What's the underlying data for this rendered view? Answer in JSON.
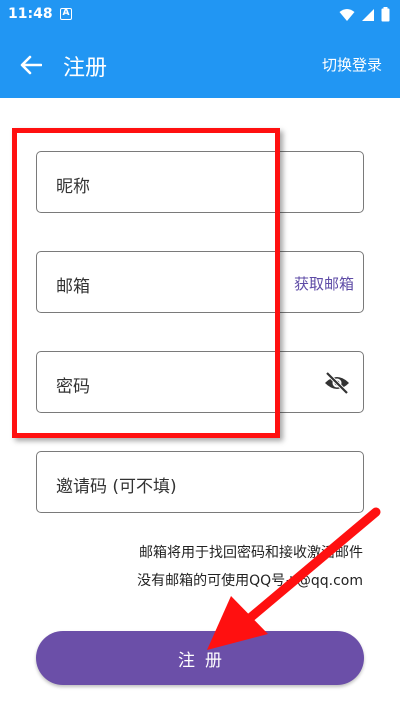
{
  "status_bar": {
    "time": "11:48",
    "notification_letter": "A"
  },
  "app_bar": {
    "title": "注册",
    "switch_login": "切换登录"
  },
  "form": {
    "nickname_label": "昵称",
    "email_label": "邮箱",
    "get_email_label": "获取邮箱",
    "password_label": "密码",
    "invite_code_label": "邀请码 (可不填)"
  },
  "hint": {
    "line1": "邮箱将用于找回密码和接收激活邮件",
    "line2": "没有邮箱的可使用QQ号+@qq.com"
  },
  "register_button": "注册",
  "colors": {
    "primary": "#2196f3",
    "button": "#6b4fa8",
    "annotation": "#ff1010",
    "link": "#5e4ba6"
  },
  "icons": [
    "back-arrow-icon",
    "eye-off-icon",
    "wifi-icon",
    "signal-icon",
    "battery-icon"
  ]
}
